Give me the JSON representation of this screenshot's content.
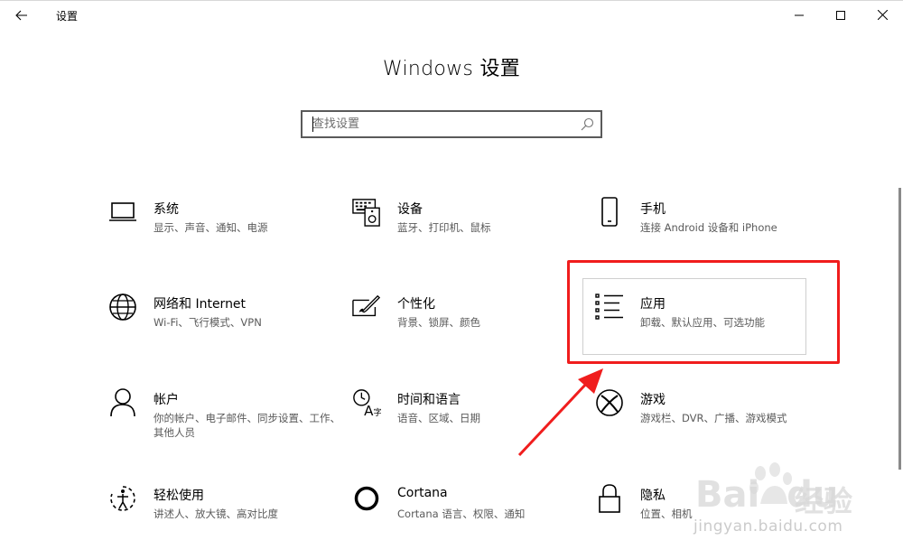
{
  "window": {
    "title": "设置"
  },
  "page": {
    "title": "Windows 设置"
  },
  "search": {
    "placeholder": "查找设置",
    "value": ""
  },
  "tiles": [
    {
      "title": "系统",
      "desc": "显示、声音、通知、电源",
      "icon": "laptop-icon"
    },
    {
      "title": "设备",
      "desc": "蓝牙、打印机、鼠标",
      "icon": "keyboard-speaker-icon"
    },
    {
      "title": "手机",
      "desc": "连接 Android 设备和 iPhone",
      "icon": "phone-icon"
    },
    {
      "title": "网络和 Internet",
      "desc": "Wi-Fi、飞行模式、VPN",
      "icon": "globe-icon"
    },
    {
      "title": "个性化",
      "desc": "背景、锁屏、颜色",
      "icon": "paint-brush-icon"
    },
    {
      "title": "应用",
      "desc": "卸载、默认应用、可选功能",
      "icon": "apps-list-icon"
    },
    {
      "title": "帐户",
      "desc": "你的帐户、电子邮件、同步设置、工作、其他人员",
      "icon": "person-icon"
    },
    {
      "title": "时间和语言",
      "desc": "语音、区域、日期",
      "icon": "time-language-icon"
    },
    {
      "title": "游戏",
      "desc": "游戏栏、DVR、广播、游戏模式",
      "icon": "xbox-icon"
    },
    {
      "title": "轻松使用",
      "desc": "讲述人、放大镜、高对比度",
      "icon": "ease-of-access-icon"
    },
    {
      "title": "Cortana",
      "desc": "Cortana 语言、权限、通知",
      "icon": "cortana-icon"
    },
    {
      "title": "隐私",
      "desc": "位置、相机",
      "icon": "lock-icon"
    }
  ],
  "watermark": {
    "brand": "Bai",
    "brand2": "du",
    "cn": "经验",
    "url": "jingyan.baidu.com"
  },
  "colors": {
    "highlight": "#f01d1d",
    "text": "#000000",
    "desc": "#5a5a5a"
  }
}
